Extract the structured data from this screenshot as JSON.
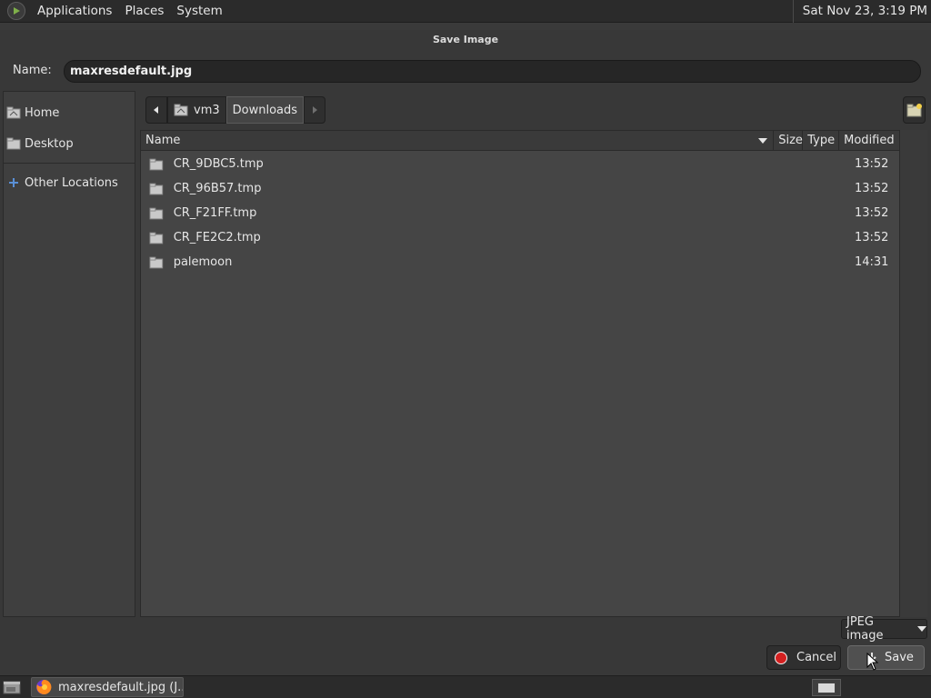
{
  "top_panel": {
    "menus": [
      "Applications",
      "Places",
      "System"
    ],
    "clock": "Sat Nov 23,  3:19 PM"
  },
  "dialog": {
    "title": "Save Image",
    "name_label": "Name:",
    "name_value": "maxresdefault.jpg"
  },
  "sidebar": {
    "items": [
      {
        "label": "Home",
        "icon": "home-icon"
      },
      {
        "label": "Desktop",
        "icon": "folder-icon"
      },
      {
        "label": "Other Locations",
        "icon": "plus-icon"
      }
    ]
  },
  "pathbar": {
    "segments": [
      "vm3",
      "Downloads"
    ]
  },
  "file_list": {
    "columns": [
      "Name",
      "Size",
      "Type",
      "Modified"
    ],
    "rows": [
      {
        "name": "CR_9DBC5.tmp",
        "size": "",
        "type": "",
        "modified": "13:52"
      },
      {
        "name": "CR_96B57.tmp",
        "size": "",
        "type": "",
        "modified": "13:52"
      },
      {
        "name": "CR_F21FF.tmp",
        "size": "",
        "type": "",
        "modified": "13:52"
      },
      {
        "name": "CR_FE2C2.tmp",
        "size": "",
        "type": "",
        "modified": "13:52"
      },
      {
        "name": "palemoon",
        "size": "",
        "type": "",
        "modified": "14:31"
      }
    ]
  },
  "filter": {
    "selected": "JPEG image"
  },
  "buttons": {
    "cancel": "Cancel",
    "save": "Save"
  },
  "taskbar": {
    "task_label": "maxresdefault.jpg (J..."
  },
  "colors": {
    "cancel_icon": "#d32020",
    "background": "#383838",
    "list_background": "#454545"
  }
}
